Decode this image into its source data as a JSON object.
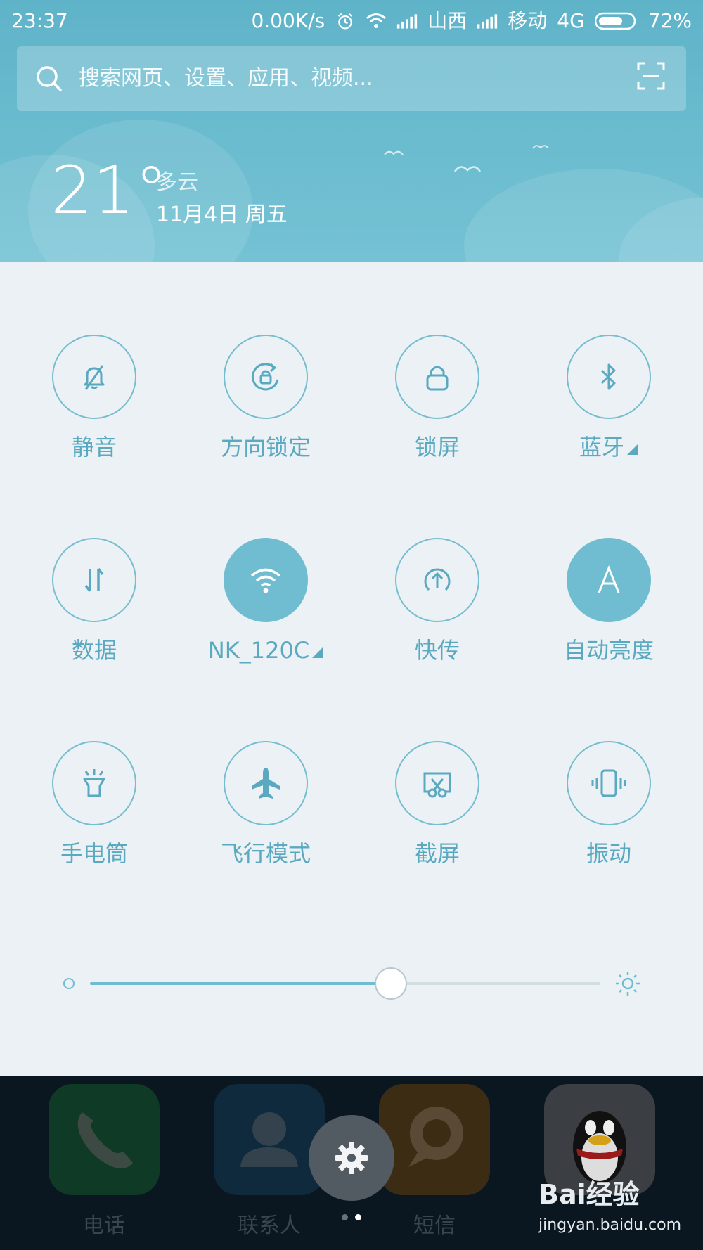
{
  "status_bar": {
    "time": "23:37",
    "net_speed": "0.00K/s",
    "carrier1": "山西",
    "carrier2": "移动",
    "network_type": "4G",
    "battery_percent": "72%",
    "battery_level": 0.72,
    "icons": [
      "alarm-icon",
      "wifi-icon",
      "signal-icon",
      "battery-icon"
    ]
  },
  "search": {
    "placeholder": "搜索网页、设置、应用、视频..."
  },
  "weather": {
    "temperature": "21°",
    "condition": "多云",
    "date": "11月4日 周五"
  },
  "quick_settings": {
    "tiles": [
      {
        "label": "静音",
        "icon": "bell-muted-icon",
        "active": false,
        "has_menu": false
      },
      {
        "label": "方向锁定",
        "icon": "rotation-lock-icon",
        "active": false,
        "has_menu": false
      },
      {
        "label": "锁屏",
        "icon": "lock-icon",
        "active": false,
        "has_menu": false
      },
      {
        "label": "蓝牙",
        "icon": "bluetooth-icon",
        "active": false,
        "has_menu": true
      },
      {
        "label": "数据",
        "icon": "data-arrows-icon",
        "active": false,
        "has_menu": false
      },
      {
        "label": "NK_120C",
        "icon": "wifi-icon",
        "active": true,
        "has_menu": true
      },
      {
        "label": "快传",
        "icon": "quick-transfer-icon",
        "active": false,
        "has_menu": false
      },
      {
        "label": "自动亮度",
        "icon": "auto-brightness-icon",
        "active": true,
        "has_menu": false
      },
      {
        "label": "手电筒",
        "icon": "flashlight-icon",
        "active": false,
        "has_menu": false
      },
      {
        "label": "飞行模式",
        "icon": "airplane-icon",
        "active": false,
        "has_menu": false
      },
      {
        "label": "截屏",
        "icon": "screenshot-icon",
        "active": false,
        "has_menu": false
      },
      {
        "label": "振动",
        "icon": "vibrate-icon",
        "active": false,
        "has_menu": false
      }
    ]
  },
  "brightness": {
    "level": 0.59
  },
  "colors": {
    "accent": "#70bcd0",
    "header": "#6bbccf",
    "panel": "#ebf1f4"
  },
  "dock": {
    "apps": [
      {
        "label": "电话",
        "icon": "phone-icon",
        "color": "#0f3a26"
      },
      {
        "label": "联系人",
        "icon": "contacts-icon",
        "color": "#0e2a3c"
      },
      {
        "label": "短信",
        "icon": "message-icon",
        "color": "#3d2c14"
      }
    ],
    "page_dots": 2,
    "active_dot": 1
  },
  "watermark": {
    "brand": "Bai经验",
    "url": "jingyan.baidu.com"
  }
}
